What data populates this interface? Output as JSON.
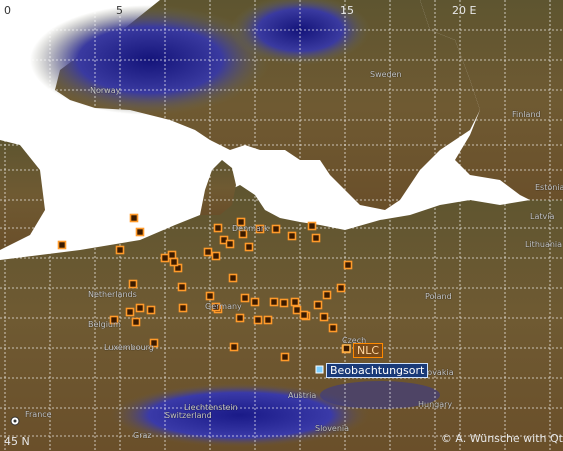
{
  "map": {
    "lon_labels": [
      {
        "text": "0",
        "lon": 0
      },
      {
        "text": "5",
        "lon": 5
      },
      {
        "text": "15",
        "lon": 15
      },
      {
        "text": "20 E",
        "lon": 20
      }
    ],
    "lat_label": "45 N",
    "credit": "© A. Wünsche with Qt",
    "place_labels": [
      {
        "text": "Norway",
        "id": "norway"
      },
      {
        "text": "Sweden",
        "id": "sweden"
      },
      {
        "text": "Finland",
        "id": "finland"
      },
      {
        "text": "Estonia",
        "id": "estonia"
      },
      {
        "text": "Latvia",
        "id": "latvia"
      },
      {
        "text": "Lithuania",
        "id": "lithuania"
      },
      {
        "text": "Denmark",
        "id": "denmark"
      },
      {
        "text": "Netherlands",
        "id": "netherlands"
      },
      {
        "text": "Belgium",
        "id": "belgium"
      },
      {
        "text": "Luxembourg",
        "id": "luxembourg"
      },
      {
        "text": "Germany",
        "id": "germany"
      },
      {
        "text": "Poland",
        "id": "poland"
      },
      {
        "text": "Czech",
        "id": "czech"
      },
      {
        "text": "Slovakia",
        "id": "slovakia"
      },
      {
        "text": "Austria",
        "id": "austria"
      },
      {
        "text": "Hungary",
        "id": "hungary"
      },
      {
        "text": "Liechtenstein",
        "id": "liechtenstein"
      },
      {
        "text": "Switzerland",
        "id": "switzerland"
      },
      {
        "text": "Slovenia",
        "id": "slovenia"
      },
      {
        "text": "France",
        "id": "france"
      },
      {
        "text": "Graz",
        "id": "graz"
      }
    ],
    "markers": {
      "station_color": "#ff9a2a",
      "observation_color": "#7fd0ff",
      "nlc_label": "NLC",
      "observation_label": "Beobachtungsort",
      "station_count": 56
    },
    "colors": {
      "water": "#ffffff",
      "lowland": "#6e5a34",
      "highland": "#2a2a9a",
      "grid": "#ffffff"
    }
  }
}
